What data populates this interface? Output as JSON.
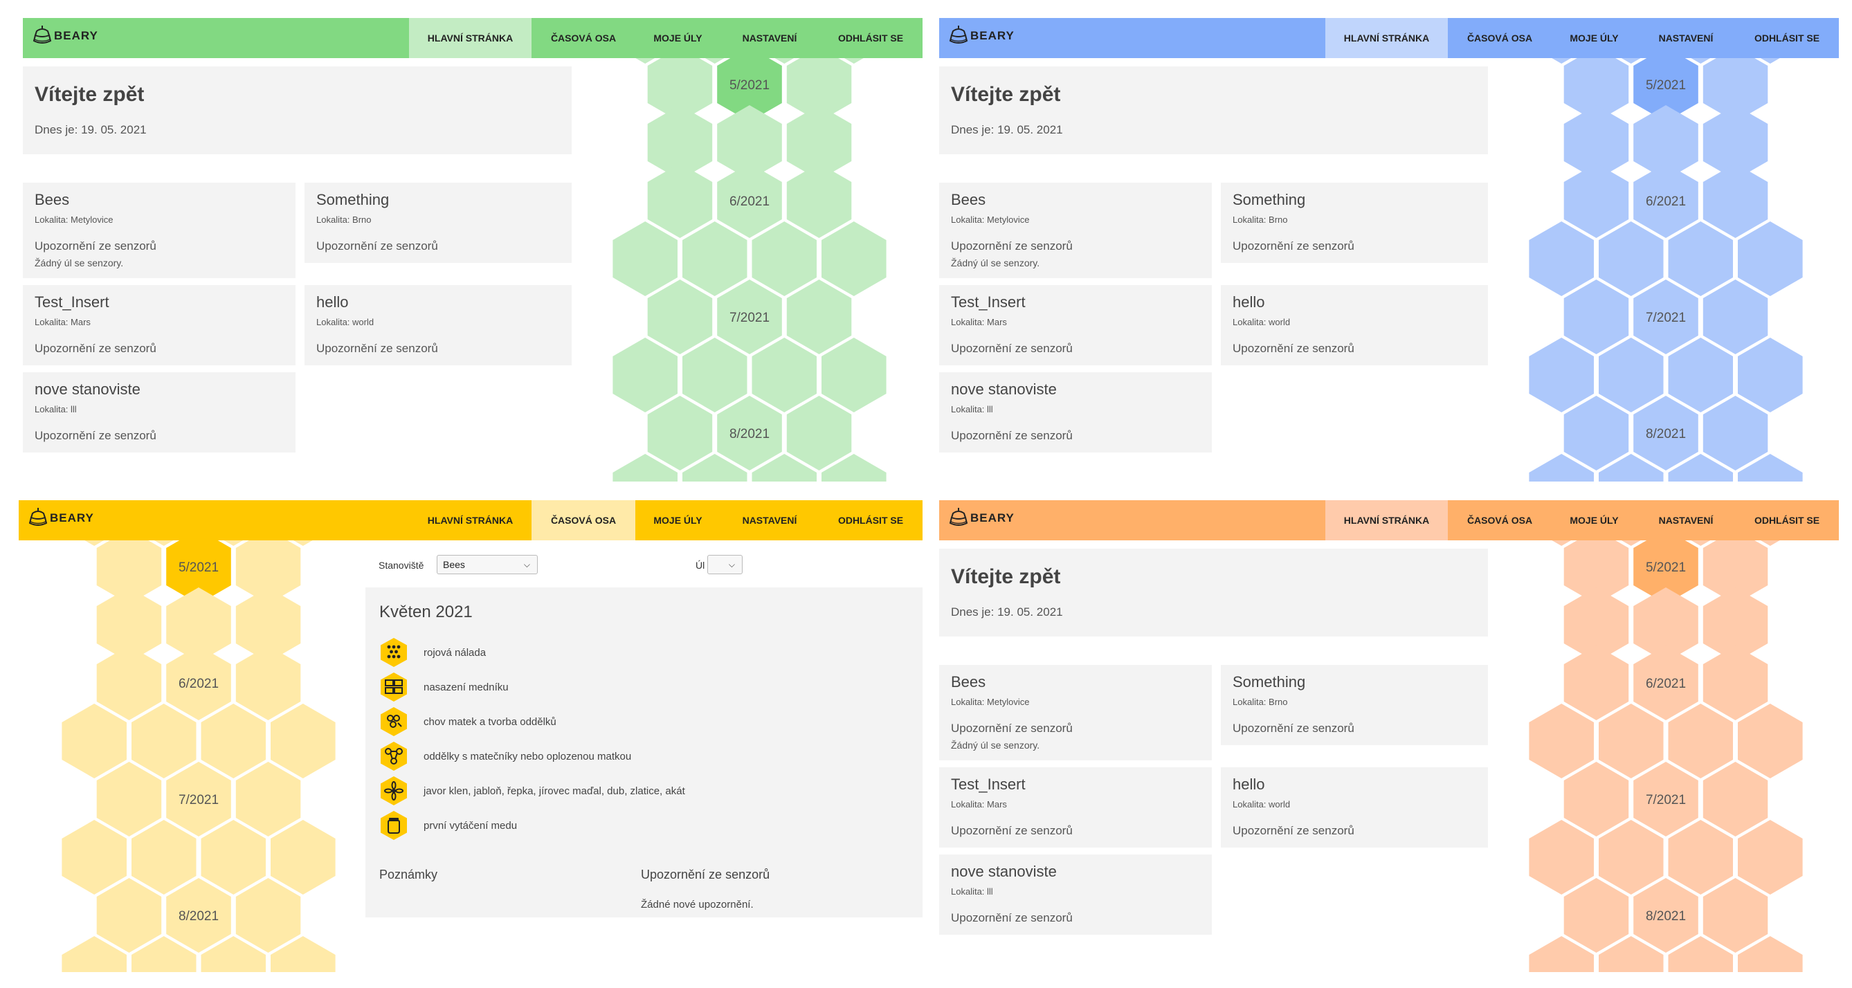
{
  "app": {
    "logo_text": "BEARY"
  },
  "nav": {
    "home": "HLAVNÍ STRÁNKA",
    "timeline": "ČASOVÁ OSA",
    "hives": "MOJE ÚLY",
    "settings": "NASTAVENÍ",
    "logout": "ODHLÁSIT SE"
  },
  "themes": {
    "green": {
      "nav": "#82d982",
      "active_tab": "#c3ecc3",
      "hex": "#c3ecc3",
      "hex_current": "#82d982"
    },
    "blue": {
      "nav": "#82acfa",
      "active_tab": "#c0d5fc",
      "hex": "#adc8fb",
      "hex_current": "#82acfa"
    },
    "yellow": {
      "nav": "#ffc800",
      "active_tab": "#ffeaa8",
      "hex": "#ffeaa8",
      "hex_current": "#ffc800"
    },
    "orange": {
      "nav": "#ffb069",
      "active_tab": "#ffcbab",
      "hex": "#ffcbab",
      "hex_current": "#ffb069"
    }
  },
  "home": {
    "welcome_title": "Vítejte zpět",
    "date_label": "Dnes je: 19. 05. 2021",
    "hives": [
      {
        "name": "Bees",
        "location": "Lokalita: Metylovice",
        "alert_title": "Upozornění ze senzorů",
        "alert_note": "Žádný úl se senzory."
      },
      {
        "name": "Something",
        "location": "Lokalita: Brno",
        "alert_title": "Upozornění ze senzorů",
        "alert_note": ""
      },
      {
        "name": "Test_Insert",
        "location": "Lokalita: Mars",
        "alert_title": "Upozornění ze senzorů",
        "alert_note": ""
      },
      {
        "name": "hello",
        "location": "Lokalita: world",
        "alert_title": "Upozornění ze senzorů",
        "alert_note": ""
      },
      {
        "name": "nove stanoviste",
        "location": "Lokalita: lll",
        "alert_title": "Upozornění ze senzorů",
        "alert_note": ""
      }
    ]
  },
  "months": [
    "5/2021",
    "6/2021",
    "7/2021",
    "8/2021"
  ],
  "timeline": {
    "apiary_label": "Stanoviště",
    "apiary_value": "Bees",
    "hive_label": "Úl",
    "hive_value": "",
    "month_title": "Květen 2021",
    "events": [
      {
        "icon": "swarm-mood-icon",
        "text": "rojová nálada"
      },
      {
        "icon": "honey-super-icon",
        "text": "nasazení medníku"
      },
      {
        "icon": "queen-rearing-icon",
        "text": "chov matek a tvorba oddělků"
      },
      {
        "icon": "nucleus-colony-icon",
        "text": "oddělky s matečníky nebo oplozenou matkou"
      },
      {
        "icon": "flower-icon",
        "text": "javor klen, jabloň, řepka, jírovec maďal, dub, zlatice, akát"
      },
      {
        "icon": "honey-jar-icon",
        "text": "první vytáčení medu"
      }
    ],
    "notes_title": "Poznámky",
    "sensors_title": "Upozornění ze senzorů",
    "sensors_note": "Žádné nové upozornění."
  }
}
